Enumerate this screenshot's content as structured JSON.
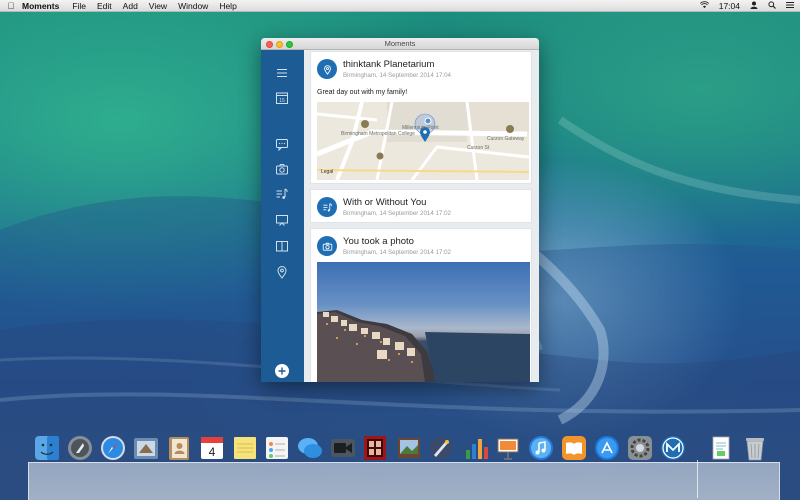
{
  "menubar": {
    "app_name": "Moments",
    "items": [
      "File",
      "Edit",
      "Add",
      "View",
      "Window",
      "Help"
    ],
    "clock": "17:04",
    "status_icons": [
      "apple-icon",
      "wifi-icon",
      "user-icon",
      "search-icon",
      "list-icon"
    ]
  },
  "window": {
    "title": "Moments"
  },
  "sidebar": {
    "icons": [
      "hamburger-menu-icon",
      "calendar-icon",
      "message-icon",
      "camera-icon",
      "music-icon",
      "screen-icon",
      "book-icon",
      "location-pin-icon"
    ],
    "calendar_day": "15",
    "add_icon": "plus-icon"
  },
  "feed": [
    {
      "icon": "location-pin-icon",
      "title": "thinktank Planetarium",
      "meta": "Birmingham, 14 September 2014 17:04",
      "body": "Great day out with my family!",
      "map": {
        "labels": [
          "Birmingham Metropolitan College",
          "Millennium Point",
          "Curzon Gateway",
          "Curzon St",
          "Legal"
        ]
      }
    },
    {
      "icon": "music-icon",
      "title": "With or Without You",
      "meta": "Birmingham, 14 September 2014 17:02"
    },
    {
      "icon": "camera-icon",
      "title": "You took a photo",
      "meta": "Birmingham, 14 September 2014 17:02"
    }
  ],
  "dock": {
    "apps": [
      "finder",
      "launchpad",
      "safari",
      "mail",
      "contacts",
      "calendar",
      "notes",
      "reminders",
      "messages",
      "facetime",
      "photo-booth",
      "iphoto",
      "pixelmator",
      "numbers",
      "keynote",
      "itunes",
      "ibooks",
      "app-store",
      "system-preferences",
      "moments",
      "preview",
      "trash"
    ],
    "calendar_day": "4"
  },
  "colors": {
    "sidebar": "#1c5b94",
    "accent": "#1f6db3"
  }
}
